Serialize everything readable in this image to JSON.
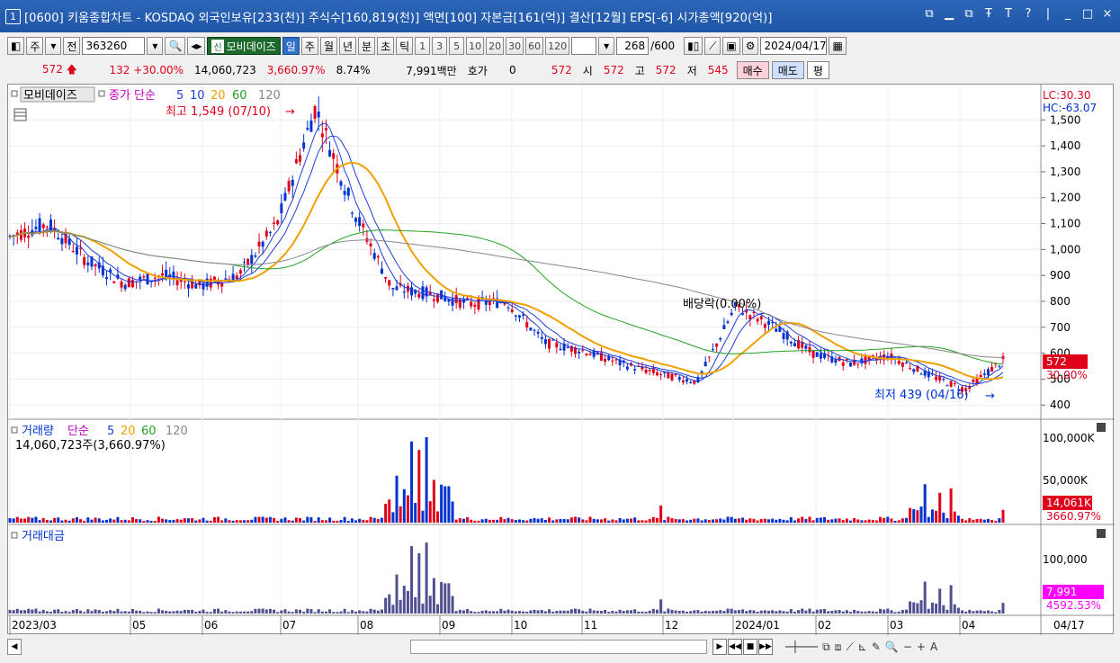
{
  "window": {
    "number": "1",
    "title": "[0600] 키움종합차트 - KOSDAQ 외국인보유[233(천)] 주식수[160,819(천)] 액면[100] 자본금[161(억)] 결산[12월] EPS[-6] 시가총액[920(억)]",
    "buttons": [
      "ⓘ",
      "_",
      "□",
      "T",
      "?",
      "|",
      "_",
      "□",
      "×"
    ]
  },
  "toolbar": {
    "market": "주",
    "prev_label": "전",
    "code": "363260",
    "name_tag": "신",
    "stock_name": "모비데이즈",
    "periods": [
      "일",
      "주",
      "월",
      "년",
      "분",
      "초",
      "틱"
    ],
    "active_period": "일",
    "intervals": [
      "1",
      "3",
      "5",
      "10",
      "20",
      "30",
      "60",
      "120"
    ],
    "count": "268",
    "count_max": "/600",
    "date": "2024/04/17"
  },
  "quote": {
    "price": "572",
    "change": "132",
    "change_pct": "+30.00%",
    "volume": "14,060,723",
    "volume_ratio": "3,660.97%",
    "turnover": "8.74%",
    "amount": "7,991백만",
    "hoga_label": "호가",
    "hoga_value": "0",
    "hoga_price": "572",
    "open_label": "시",
    "open": "572",
    "high_label": "고",
    "high": "572",
    "low_label": "저",
    "low": "545",
    "buy": "매수",
    "sell": "매도",
    "avg": "평"
  },
  "price_panel": {
    "legend_name": "모비데이즈",
    "legend_ma": "종가 단순",
    "ma_periods": [
      "5",
      "10",
      "20",
      "60",
      "120"
    ],
    "ma_colors": [
      "#1f3fd6",
      "#1f3fd6",
      "#f0a000",
      "#22a022",
      "#888888"
    ],
    "high_note": "최고 1,549 (07/10)",
    "low_note": "최저 439 (04/16)",
    "dividend_note": "배당락(0.00%)",
    "lc": "LC:30.30",
    "hc": "HC:-63.07",
    "price_tag": "572",
    "pct_tag": "30.00%",
    "y_ticks": [
      "1,500",
      "1,400",
      "1,300",
      "1,200",
      "1,100",
      "1,000",
      "900",
      "800",
      "700",
      "600",
      "500",
      "400"
    ]
  },
  "volume_panel": {
    "legend": "거래량",
    "legend_ma": "단순",
    "ma_periods": [
      "5",
      "20",
      "60",
      "120"
    ],
    "value_note": "14,060,723주(3,660.97%)",
    "y_ticks": [
      "100,000K",
      "50,000K"
    ],
    "tag_value": "14,061K",
    "tag_pct": "3660.97%"
  },
  "amount_panel": {
    "legend": "거래대금",
    "y_ticks": [
      "100,000"
    ],
    "tag_value": "7,991",
    "tag_pct": "4592.53%"
  },
  "x_axis": {
    "labels": [
      "2023/03",
      "05",
      "06",
      "07",
      "08",
      "09",
      "10",
      "11",
      "12",
      "2024/01",
      "02",
      "03",
      "04"
    ],
    "last_label": "04/17"
  },
  "chart_data": {
    "type": "line",
    "title": "",
    "x_months": [
      "2023/03",
      "05",
      "06",
      "07",
      "08",
      "09",
      "10",
      "11",
      "12",
      "2024/01",
      "02",
      "03",
      "04"
    ],
    "series": [
      {
        "name": "종가",
        "values": [
          1050,
          1100,
          960,
          870,
          900,
          860,
          900,
          1100,
          1549,
          1150,
          850,
          830,
          790,
          800,
          640,
          610,
          560,
          520,
          490,
          780,
          700,
          600,
          560,
          590,
          520,
          460,
          572
        ]
      }
    ],
    "ylim": [
      380,
      1560
    ],
    "ylabel": "",
    "xlabel": ""
  }
}
